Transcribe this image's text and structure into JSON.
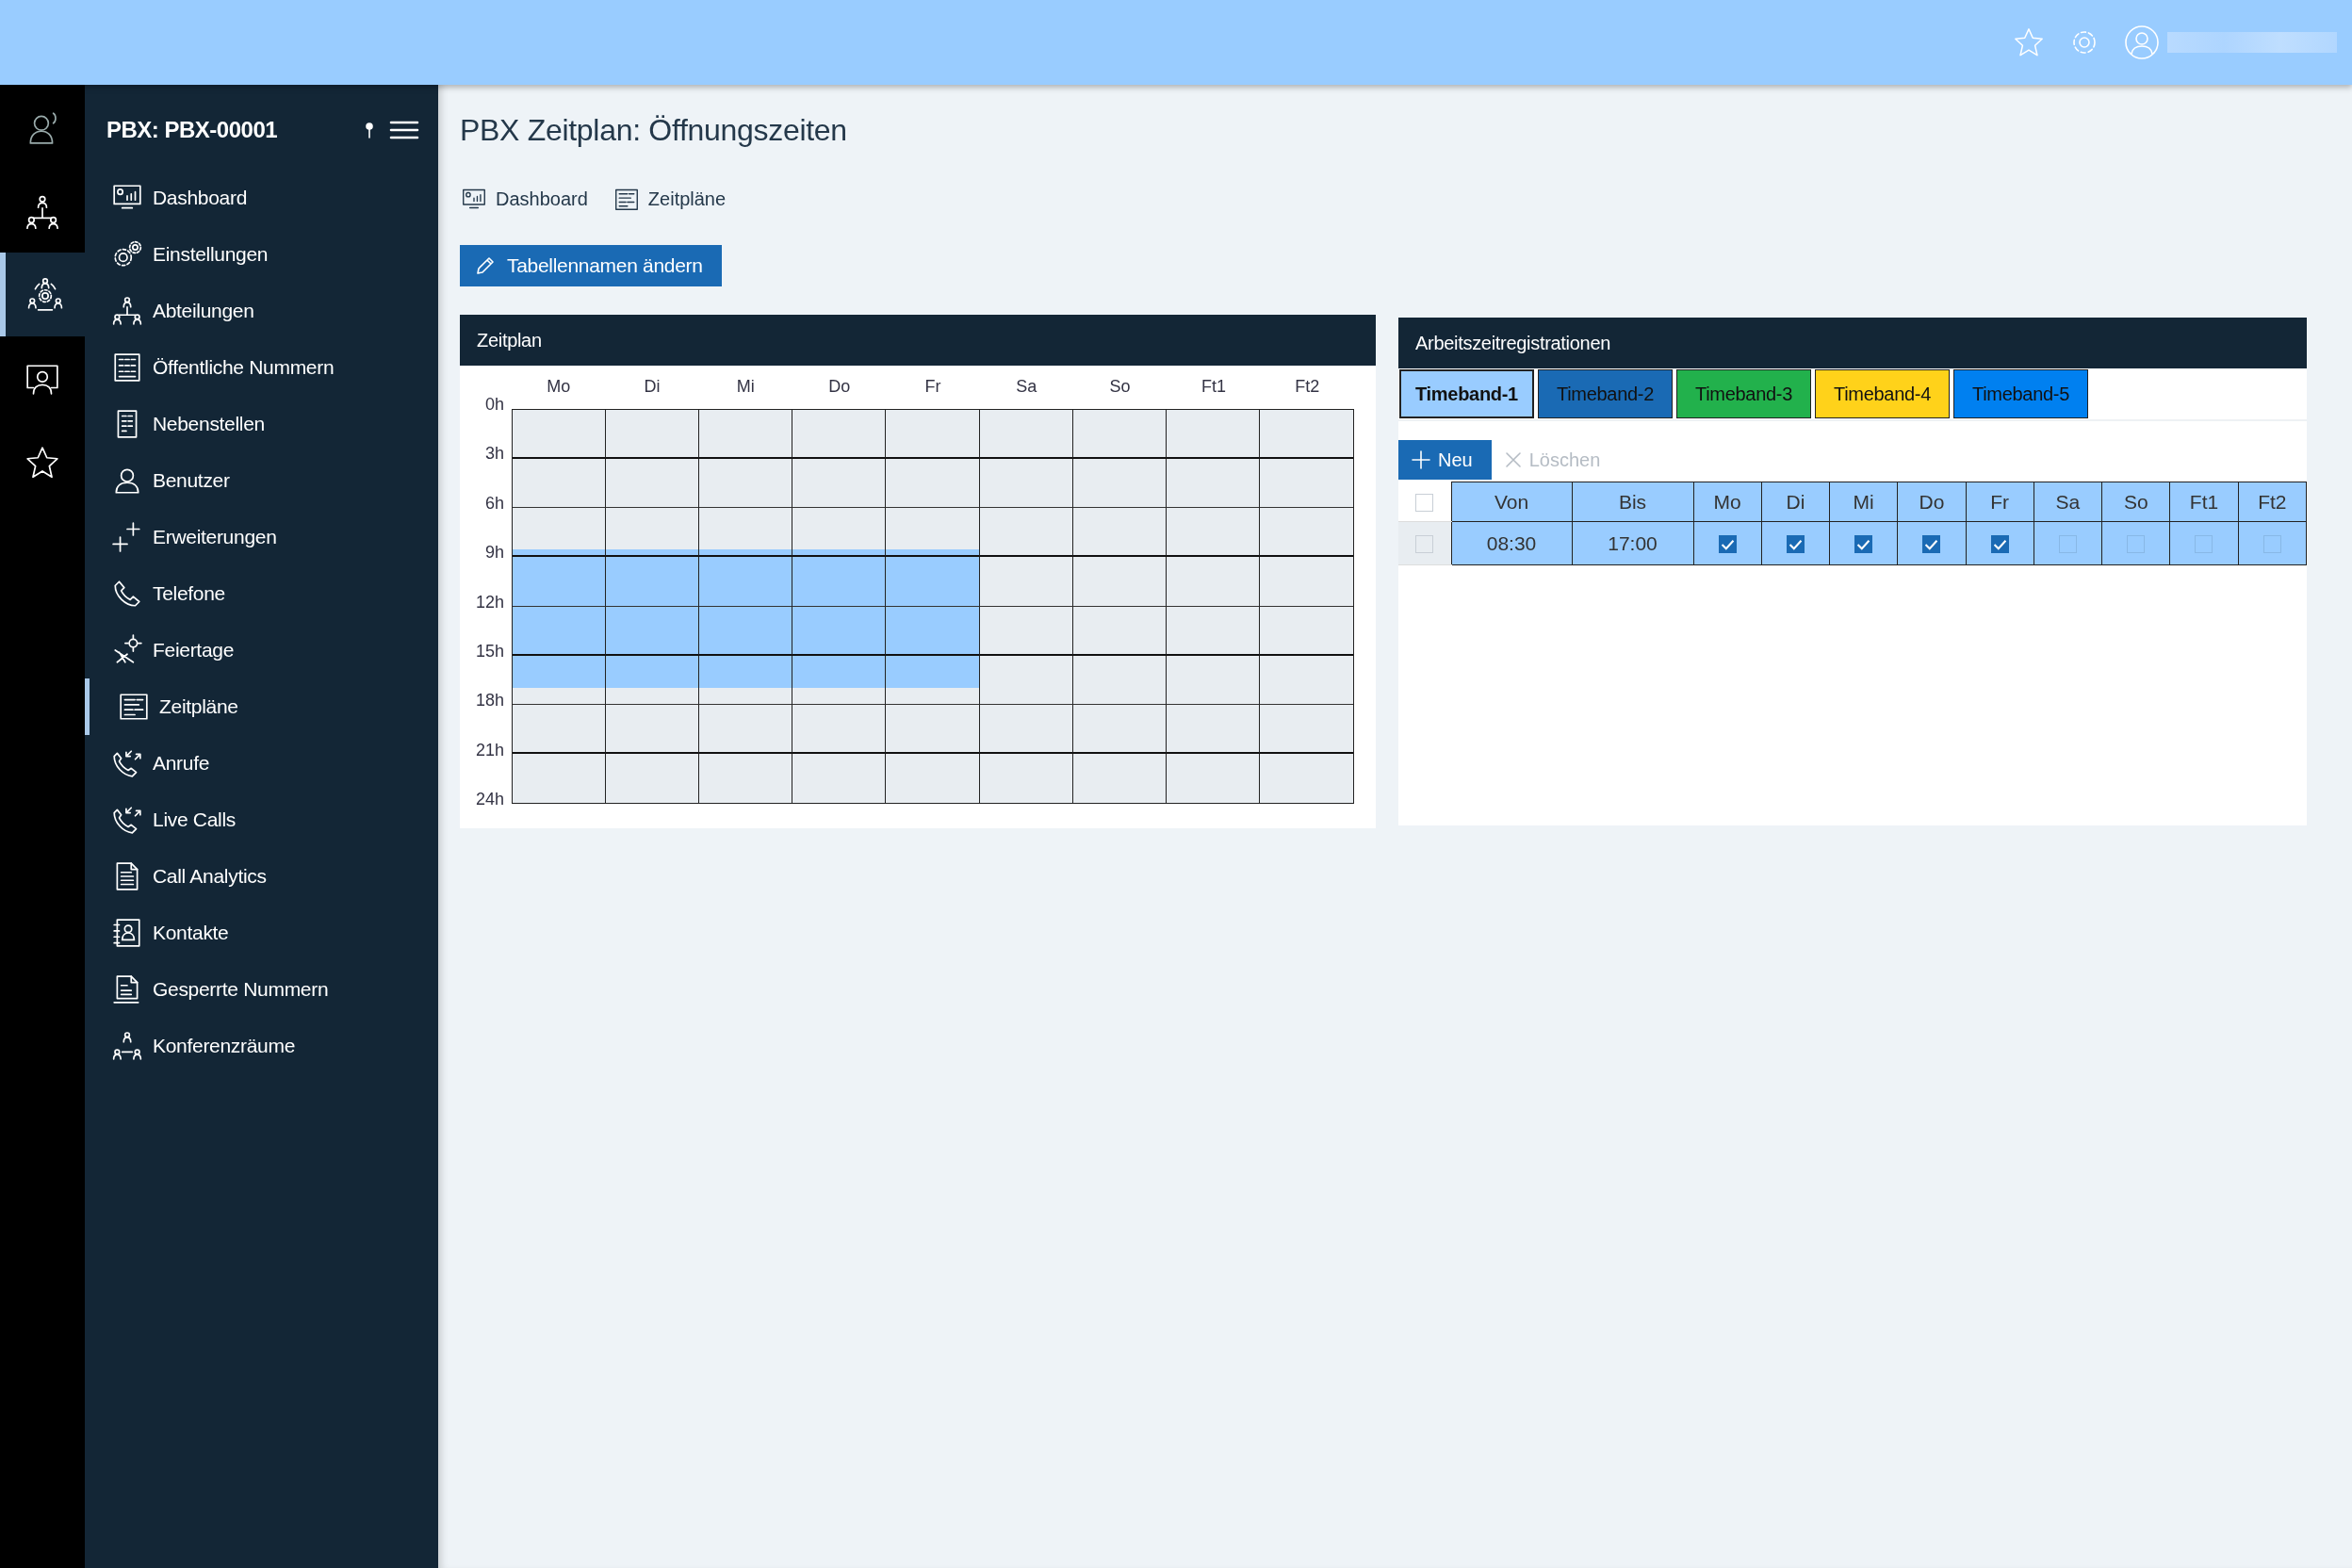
{
  "rail": {
    "items": [
      {
        "selected": false
      },
      {
        "selected": false
      },
      {
        "selected": true
      },
      {
        "selected": false
      },
      {
        "selected": false
      }
    ]
  },
  "sidebar": {
    "title": "PBX: PBX-00001",
    "items": [
      {
        "label": "Dashboard",
        "selected": false
      },
      {
        "label": "Einstellungen",
        "selected": false
      },
      {
        "label": "Abteilungen",
        "selected": false
      },
      {
        "label": "Öffentliche Nummern",
        "selected": false
      },
      {
        "label": "Nebenstellen",
        "selected": false
      },
      {
        "label": "Benutzer",
        "selected": false
      },
      {
        "label": "Erweiterungen",
        "selected": false
      },
      {
        "label": "Telefone",
        "selected": false
      },
      {
        "label": "Feiertage",
        "selected": false
      },
      {
        "label": "Zeitpläne",
        "selected": true
      },
      {
        "label": "Anrufe",
        "selected": false
      },
      {
        "label": "Live Calls",
        "selected": false
      },
      {
        "label": "Call Analytics",
        "selected": false
      },
      {
        "label": "Kontakte",
        "selected": false
      },
      {
        "label": "Gesperrte Nummern",
        "selected": false
      },
      {
        "label": "Konferenzräume",
        "selected": false
      }
    ]
  },
  "page": {
    "title": "PBX Zeitplan: Öffnungszeiten",
    "breadcrumbs": [
      "Dashboard",
      "Zeitpläne"
    ],
    "rename_button": "Tabellennamen ändern"
  },
  "schedule": {
    "title": "Zeitplan",
    "columns": [
      "Mo",
      "Di",
      "Mi",
      "Do",
      "Fr",
      "Sa",
      "So",
      "Ft1",
      "Ft2"
    ],
    "hours": [
      "0h",
      "3h",
      "6h",
      "9h",
      "12h",
      "15h",
      "18h",
      "21h",
      "24h"
    ]
  },
  "registrations": {
    "title": "Arbeitszeitregistrationen",
    "tabs": [
      {
        "label": "Timeband-1",
        "selected": true,
        "color": "#99ccff"
      },
      {
        "label": "Timeband-2",
        "selected": false,
        "color": "#1a6ab4"
      },
      {
        "label": "Timeband-3",
        "selected": false,
        "color": "#22b14c"
      },
      {
        "label": "Timeband-4",
        "selected": false,
        "color": "#ffd21a"
      },
      {
        "label": "Timeband-5",
        "selected": false,
        "color": "#0080f0"
      }
    ],
    "new_button": "Neu",
    "delete_button": {
      "label": "Löschen",
      "disabled": true
    },
    "select_all_checked": false,
    "columns": [
      "Von",
      "Bis",
      "Mo",
      "Di",
      "Mi",
      "Do",
      "Fr",
      "Sa",
      "So",
      "Ft1",
      "Ft2"
    ],
    "rows": [
      {
        "selected": false,
        "von": "08:30",
        "bis": "17:00",
        "days": [
          {
            "checked": true
          },
          {
            "checked": true
          },
          {
            "checked": true
          },
          {
            "checked": true
          },
          {
            "checked": true
          },
          {
            "checked": false
          },
          {
            "checked": false
          },
          {
            "checked": false
          },
          {
            "checked": false
          }
        ]
      }
    ]
  }
}
